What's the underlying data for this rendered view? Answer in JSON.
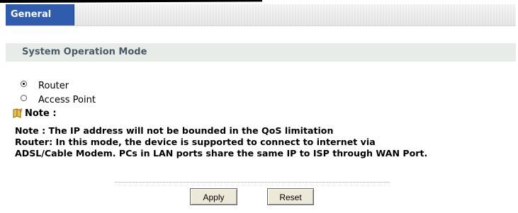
{
  "tabs": [
    {
      "label": "General",
      "active": true
    }
  ],
  "section": {
    "title": "System Operation Mode"
  },
  "mode_options": [
    {
      "label": "Router",
      "checked": true
    },
    {
      "label": "Access Point",
      "checked": false
    }
  ],
  "note": {
    "label": "Note :",
    "icon": "note-icon",
    "lines": [
      "Note : The IP address will not be bounded in the QoS limitation",
      "Router: In this mode, the device is supported to connect to internet via",
      "ADSL/Cable Modem. PCs in LAN ports share the same IP to ISP through WAN Port."
    ]
  },
  "buttons": {
    "apply": "Apply",
    "reset": "Reset"
  },
  "colors": {
    "tab_active_bg": "#2f5cad",
    "section_header_bg": "#e8ece8",
    "section_header_text": "#4a5a64"
  }
}
